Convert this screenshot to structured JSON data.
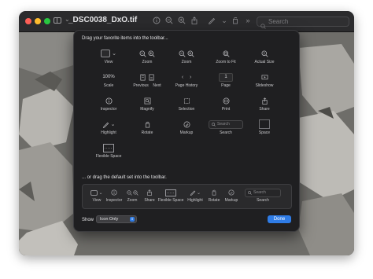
{
  "window": {
    "title": "_DSC0038_DxO.tif",
    "search_placeholder": "Search",
    "toolbar_icons": [
      "info-icon",
      "zoom-out-icon",
      "zoom-in-icon",
      "share-icon",
      "markup-icon",
      "rotate-icon",
      "more-icon"
    ]
  },
  "sheet": {
    "heading": "Drag your favorite items into the toolbar...",
    "items": [
      {
        "label": "View",
        "icon": "view-icon"
      },
      {
        "label": "Zoom",
        "icon": "zoom-icon"
      },
      {
        "label": "Zoom",
        "icon": "zoom-icon"
      },
      {
        "label": "Zoom to Fit",
        "icon": "zoom-to-fit-icon"
      },
      {
        "label": "Actual Size",
        "icon": "actual-size-icon"
      },
      {
        "label": "Scale",
        "icon": "scale-value",
        "value": "100%"
      },
      {
        "label": "Previous",
        "icon": "previous-icon"
      },
      {
        "label": "Next",
        "icon": "next-icon"
      },
      {
        "label": "Page History",
        "icon": "page-history-icon"
      },
      {
        "label": "Page",
        "icon": "page-box",
        "value": "1"
      },
      {
        "label": "Slideshow",
        "icon": "slideshow-icon"
      },
      {
        "label": "Inspector",
        "icon": "info-icon"
      },
      {
        "label": "Magnify",
        "icon": "magnify-icon"
      },
      {
        "label": "Selection",
        "icon": "selection-icon"
      },
      {
        "label": "Print",
        "icon": "print-icon"
      },
      {
        "label": "Share",
        "icon": "share-icon"
      },
      {
        "label": "Highlight",
        "icon": "highlight-icon"
      },
      {
        "label": "Rotate",
        "icon": "rotate-icon"
      },
      {
        "label": "Markup",
        "icon": "markup-icon"
      },
      {
        "label": "Search",
        "icon": "search-field",
        "placeholder": "Search"
      },
      {
        "label": "Space",
        "icon": "space-box"
      },
      {
        "label": "Flexible Space",
        "icon": "flexible-space-box"
      }
    ],
    "default_heading": "... or drag the default set into the toolbar.",
    "default_set": [
      {
        "label": "View",
        "icon": "view-icon"
      },
      {
        "label": "Inspector",
        "icon": "info-icon"
      },
      {
        "label": "Zoom",
        "icon": "zoom-icon"
      },
      {
        "label": "Share",
        "icon": "share-icon"
      },
      {
        "label": "Flexible Space",
        "icon": "flexible-space-box"
      },
      {
        "label": "Highlight",
        "icon": "highlight-icon"
      },
      {
        "label": "Rotate",
        "icon": "rotate-icon"
      },
      {
        "label": "Markup",
        "icon": "markup-icon"
      },
      {
        "label": "Search",
        "icon": "search-field",
        "placeholder": "Search"
      }
    ],
    "show_label": "Show",
    "show_value": "Icon Only",
    "done_label": "Done"
  },
  "colors": {
    "accent": "#2f7ce6",
    "sheet_bg": "#1f1f21",
    "close": "#fe5f57",
    "minimize": "#febc2e",
    "zoom": "#28c840"
  }
}
